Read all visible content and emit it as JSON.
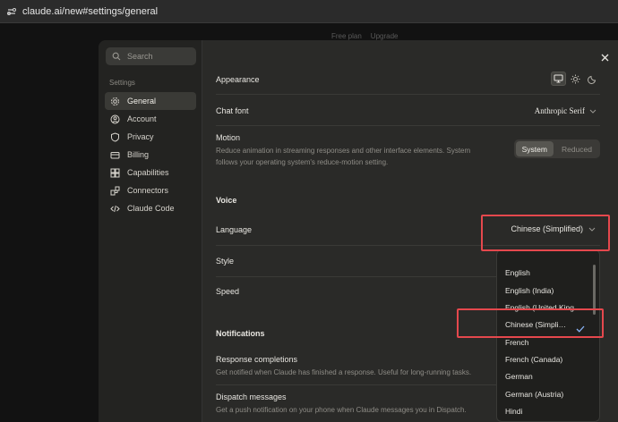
{
  "browser": {
    "url": "claude.ai/new#settings/general"
  },
  "background": {
    "plan_label": "Free plan",
    "upgrade_label": "Upgrade"
  },
  "sidebar": {
    "search_placeholder": "Search",
    "section_label": "Settings",
    "items": [
      {
        "label": "General",
        "icon": "gear-icon",
        "active": true
      },
      {
        "label": "Account",
        "icon": "user-icon"
      },
      {
        "label": "Privacy",
        "icon": "shield-icon"
      },
      {
        "label": "Billing",
        "icon": "card-icon"
      },
      {
        "label": "Capabilities",
        "icon": "grid-icon"
      },
      {
        "label": "Connectors",
        "icon": "plug-icon"
      },
      {
        "label": "Claude Code",
        "icon": "code-icon"
      }
    ]
  },
  "settings": {
    "appearance_label": "Appearance",
    "appearance_options": [
      "system",
      "light",
      "dark"
    ],
    "appearance_selected": "system",
    "chat_font_label": "Chat font",
    "chat_font_value": "Anthropic Serif",
    "motion_label": "Motion",
    "motion_desc_1": "Reduce animation in streaming responses and other interface elements. System",
    "motion_desc_2": "follows your operating system's reduce-motion setting.",
    "motion_options": [
      "System",
      "Reduced"
    ],
    "motion_selected": "System",
    "voice_heading": "Voice",
    "language_label": "Language",
    "language_value": "Chinese (Simplified)",
    "style_label": "Style",
    "speed_label": "Speed",
    "notifications_heading": "Notifications",
    "response_completions_label": "Response completions",
    "response_completions_desc": "Get notified when Claude has finished a response. Useful for long-running tasks.",
    "dispatch_label": "Dispatch messages",
    "dispatch_desc": "Get a push notification on your phone when Claude messages you in Dispatch."
  },
  "language_dropdown": {
    "options": [
      "English",
      "English (India)",
      "English (United Kingdom)",
      "Chinese (Simplified)",
      "French",
      "French (Canada)",
      "German",
      "German (Austria)",
      "Hindi"
    ],
    "options_display": [
      "English",
      "English (India)",
      "English (United King",
      "Chinese (Simpli…",
      "French",
      "French (Canada)",
      "German",
      "German (Austria)",
      "Hindi"
    ],
    "selected": "Chinese (Simplified)"
  },
  "colors": {
    "highlight_box": "#e5484d",
    "accent_check": "#8ab4f8"
  }
}
